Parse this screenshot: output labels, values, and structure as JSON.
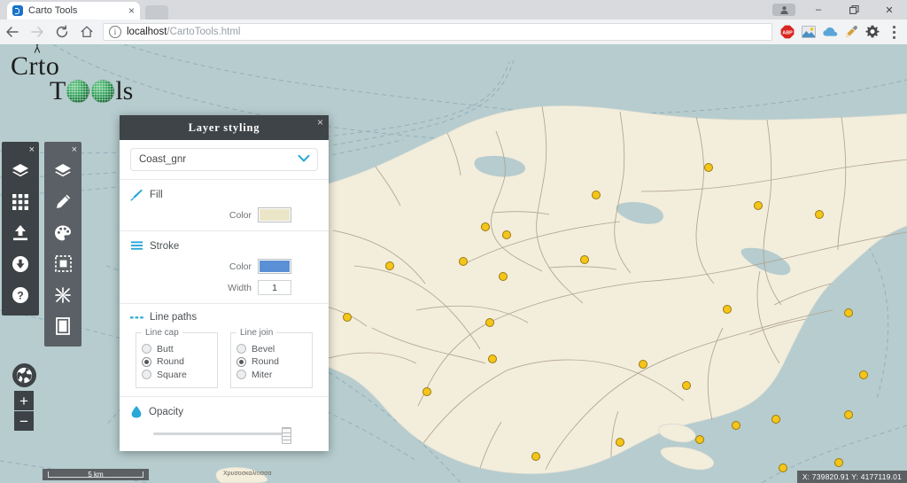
{
  "browser": {
    "tab": {
      "title": "Carto Tools",
      "favicon": "bookmark-favicon",
      "close": "×"
    },
    "newtab_button": "new-tab",
    "window_controls": {
      "profile": "profile-icon",
      "minimize": "–",
      "maximize": "❐",
      "close": "✕"
    },
    "nav": {
      "back": "←",
      "forward": "→",
      "reload": "⟳",
      "home": "⌂"
    },
    "omnibox": {
      "info_icon": "i",
      "url_host": "localhost",
      "url_path": "/CartoTools.html"
    },
    "extensions": [
      "adblock-plus-icon",
      "screenshot-icon",
      "cloud-icon",
      "eyedropper-icon",
      "settings-gear-icon",
      "chrome-menu-icon"
    ]
  },
  "logo": {
    "line1": "C",
    "line1_rest": "rto",
    "line2_pre": "T",
    "line2_post": "ls",
    "alt": "Carto Tools"
  },
  "toolbar_primary": {
    "close": "×",
    "items": [
      {
        "name": "layers-icon",
        "label": "Layers"
      },
      {
        "name": "grid-icon",
        "label": "Grid"
      },
      {
        "name": "upload-icon",
        "label": "Upload"
      },
      {
        "name": "download-icon",
        "label": "Download"
      },
      {
        "name": "help-icon",
        "label": "Help"
      }
    ]
  },
  "toolbar_secondary": {
    "close": "×",
    "items": [
      {
        "name": "layers-icon",
        "label": "Layers"
      },
      {
        "name": "pencil-icon",
        "label": "Edit"
      },
      {
        "name": "palette-icon",
        "label": "Styling"
      },
      {
        "name": "selection-icon",
        "label": "Select"
      },
      {
        "name": "split-icon",
        "label": "Split"
      },
      {
        "name": "page-icon",
        "label": "Page"
      }
    ]
  },
  "map_controls": {
    "globe_button": "globe-icon",
    "zoom_in": "+",
    "zoom_out": "−",
    "scale_label": "5 km",
    "coordinates": "X: 739820.91   Y: 4177119.01",
    "place_label": "Χρυσοσκαλίτισσα"
  },
  "panel": {
    "title": "Layer styling",
    "close": "×",
    "layer_select": {
      "value": "Coast_gnr",
      "chevron": "chevron-down-icon"
    },
    "fill": {
      "heading": "Fill",
      "icon": "brush-icon",
      "color_label": "Color",
      "color_value": "#ece6c8"
    },
    "stroke": {
      "heading": "Stroke",
      "icon": "lines-icon",
      "color_label": "Color",
      "color_value": "#5b8fd6",
      "width_label": "Width",
      "width_value": "1"
    },
    "line_paths": {
      "heading": "Line paths",
      "icon": "dashed-line-icon",
      "line_cap": {
        "legend": "Line cap",
        "options": [
          "Butt",
          "Round",
          "Square"
        ],
        "selected": "Round"
      },
      "line_join": {
        "legend": "Line join",
        "options": [
          "Bevel",
          "Round",
          "Miter"
        ],
        "selected": "Round"
      }
    },
    "opacity": {
      "heading": "Opacity",
      "icon": "droplet-icon",
      "value": 100
    }
  },
  "colors": {
    "sea": "#b6ccce",
    "land": "#f3eddc",
    "boundary": "#b0a48e",
    "marker": "#f5c518",
    "panel_header": "#3f4448",
    "toolbar_dark": "#3d4246",
    "toolbar_light": "#5a6065",
    "accent_blue": "#29a7d8"
  }
}
